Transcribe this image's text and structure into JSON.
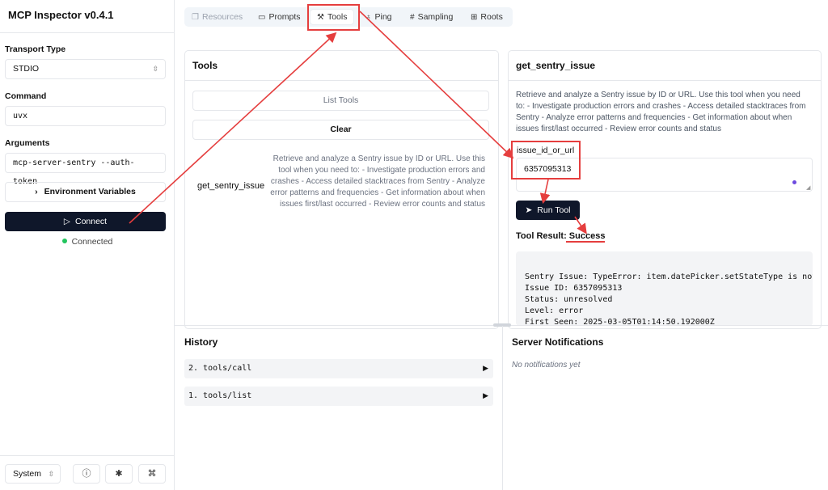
{
  "sidebar": {
    "title": "MCP Inspector v0.4.1",
    "transport_label": "Transport Type",
    "transport_value": "STDIO",
    "command_label": "Command",
    "command_value": "uvx",
    "arguments_label": "Arguments",
    "arguments_value": "mcp-server-sentry --auth-token",
    "env_button": "Environment Variables",
    "connect_button": "Connect",
    "status": "Connected",
    "theme": "System"
  },
  "tabs": [
    {
      "label": "Resources",
      "icon": "resources-icon",
      "state": "disabled"
    },
    {
      "label": "Prompts",
      "icon": "message-icon",
      "state": "normal"
    },
    {
      "label": "Tools",
      "icon": "hammer-icon",
      "state": "active"
    },
    {
      "label": "Ping",
      "icon": "bell-icon",
      "state": "normal"
    },
    {
      "label": "Sampling",
      "icon": "hash-icon",
      "state": "normal"
    },
    {
      "label": "Roots",
      "icon": "folder-tree-icon",
      "state": "normal"
    }
  ],
  "tools_panel": {
    "title": "Tools",
    "list_button": "List Tools",
    "clear_button": "Clear",
    "tool_name": "get_sentry_issue",
    "tool_description": "Retrieve and analyze a Sentry issue by ID or URL. Use this tool when you need to: - Investigate production errors and crashes - Access detailed stacktraces from Sentry - Analyze error patterns and frequencies - Get information about when issues first/last occurred - Review error counts and status"
  },
  "detail_panel": {
    "title": "get_sentry_issue",
    "description": "Retrieve and analyze a Sentry issue by ID or URL. Use this tool when you need to: - Investigate production errors and crashes - Access detailed stacktraces from Sentry - Analyze error patterns and frequencies - Get information about when issues first/last occurred - Review error counts and status",
    "param_label": "issue_id_or_url",
    "param_value": "6357095313",
    "run_button": "Run Tool",
    "result_label": "Tool Result: ",
    "result_status": "Success",
    "result_lines": [
      "Sentry Issue: TypeError: item.datePicker.setStateType is not",
      "Issue ID: 6357095313",
      "Status: unresolved",
      "Level: error",
      "First Seen: 2025-03-05T01:14:50.192000Z"
    ]
  },
  "history": {
    "title": "History",
    "items": [
      "2. tools/call",
      "1. tools/list"
    ]
  },
  "notifications": {
    "title": "Server Notifications",
    "empty": "No notifications yet"
  },
  "colors": {
    "accent_dark": "#0f172a",
    "annotation_red": "#e53e3e",
    "connected_green": "#22c55e"
  }
}
